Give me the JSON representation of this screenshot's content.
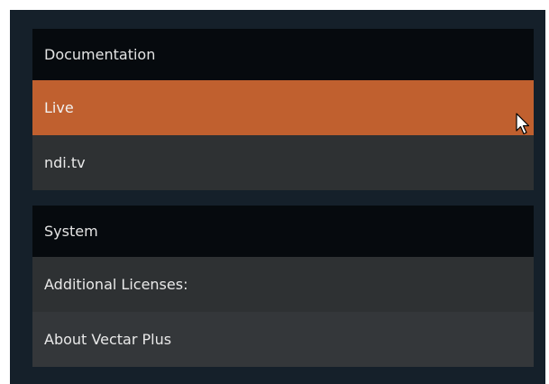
{
  "documentation": {
    "header": "Documentation",
    "items": [
      {
        "label": "Live",
        "selected": true
      },
      {
        "label": "ndi.tv",
        "selected": false
      }
    ]
  },
  "system": {
    "header": "System",
    "items": [
      {
        "label": "Additional Licenses:"
      },
      {
        "label": "About Vectar Plus"
      }
    ]
  },
  "colors": {
    "panel_bg": "#15202a",
    "header_bg": "#060a0e",
    "item_bg": "#2e3133",
    "selected_bg": "#c0602f"
  },
  "cursor": {
    "icon": "mouse-pointer-icon"
  }
}
